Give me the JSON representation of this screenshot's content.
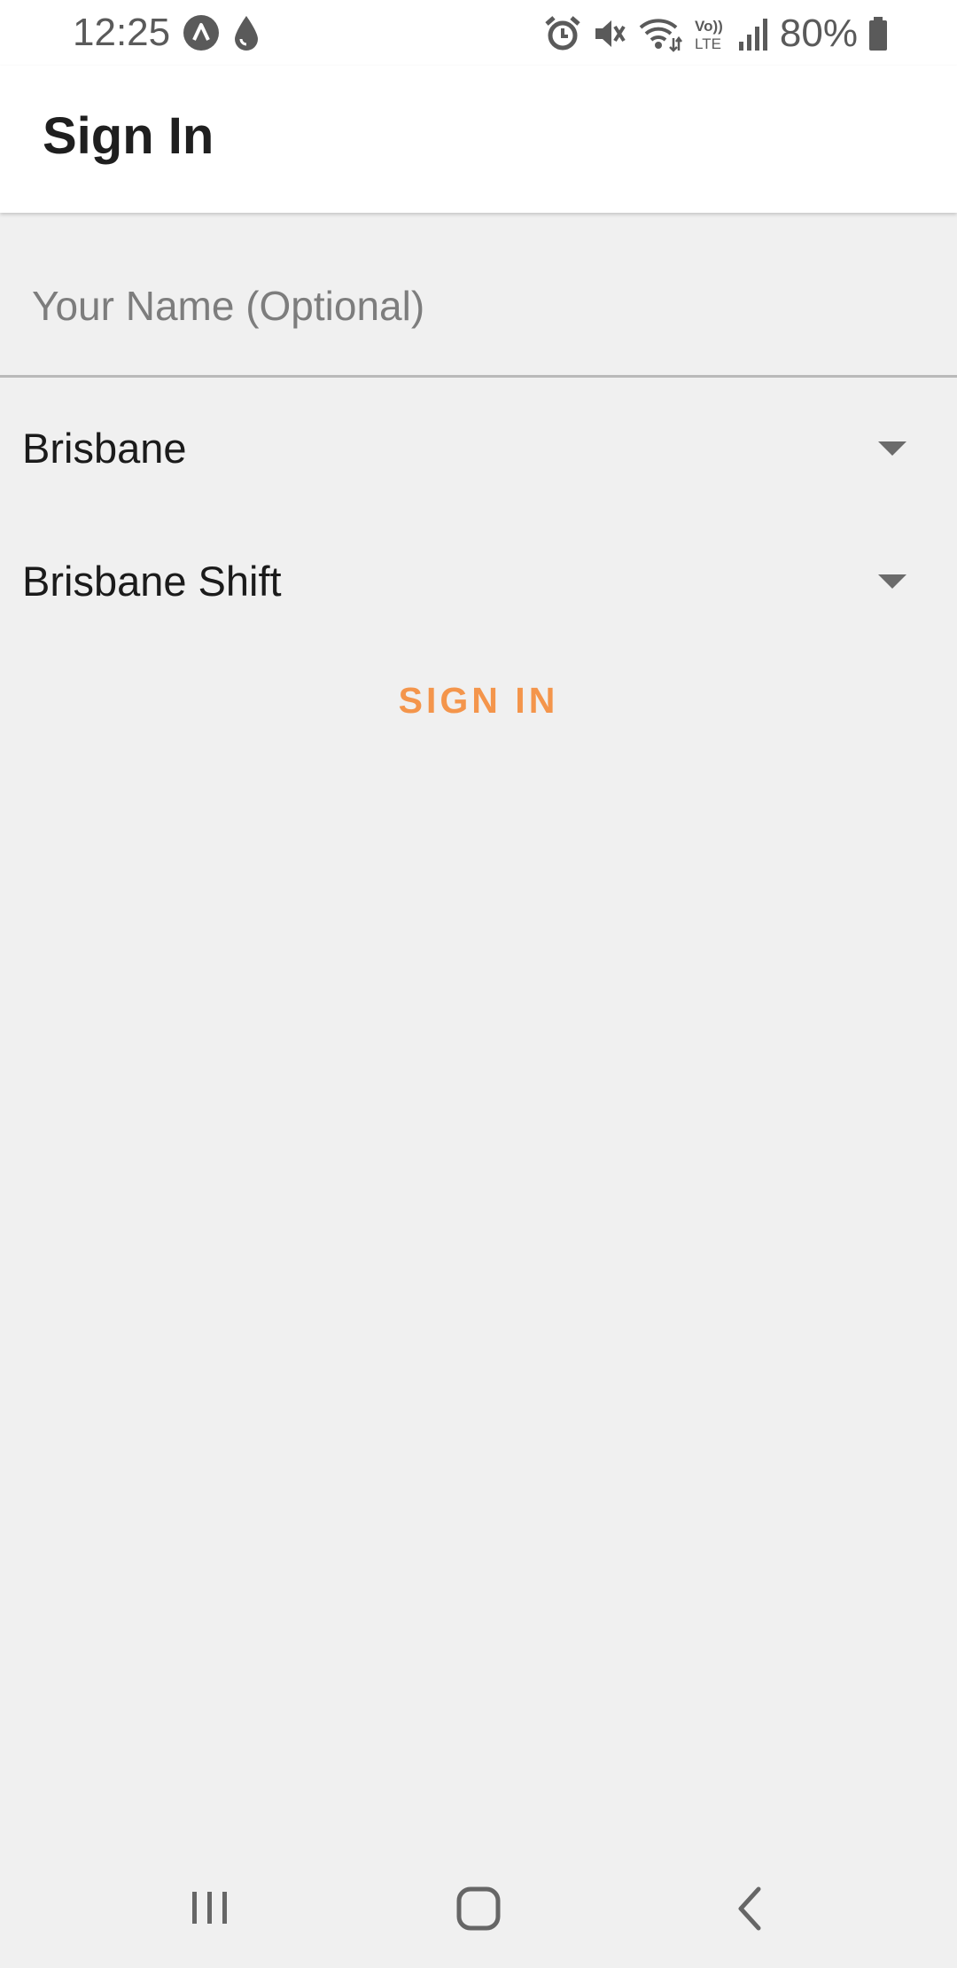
{
  "status_bar": {
    "time": "12:25",
    "battery": "80%",
    "icons_left": [
      "app-notification-icon",
      "water-drop-icon"
    ],
    "icons_right": [
      "alarm-icon",
      "mute-icon",
      "wifi-icon",
      "volte-icon",
      "signal-icon",
      "battery-icon"
    ]
  },
  "app_bar": {
    "title": "Sign In"
  },
  "form": {
    "name_placeholder": "Your Name (Optional)",
    "name_value": "",
    "location_selected": "Brisbane",
    "shift_selected": "Brisbane Shift",
    "submit_label": "SIGN IN"
  },
  "nav_bar": {
    "icons": [
      "recents-icon",
      "home-icon",
      "back-icon"
    ]
  },
  "colors": {
    "accent": "#f4954b",
    "background": "#f0f0f0",
    "app_bar": "#ffffff"
  }
}
